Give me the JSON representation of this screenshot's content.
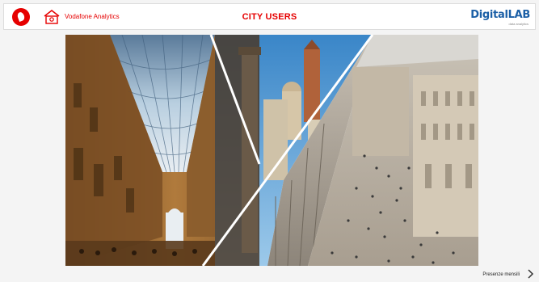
{
  "header": {
    "app_name": "Vodafone Analytics",
    "title": "CITY USERS",
    "partner_logo": "DigitalLAB",
    "partner_logo_part1": "Digital",
    "partner_logo_part2": "LAB",
    "partner_sub": "data analytics"
  },
  "footer": {
    "next_label": "Presenze mensili"
  },
  "icons": {
    "vodafone_logo": "vodafone-logo-icon",
    "analytics": "house-analytics-icon",
    "next": "chevron-right-icon"
  },
  "colors": {
    "brand_red": "#e60000",
    "partner_blue": "#1b5fa6"
  }
}
